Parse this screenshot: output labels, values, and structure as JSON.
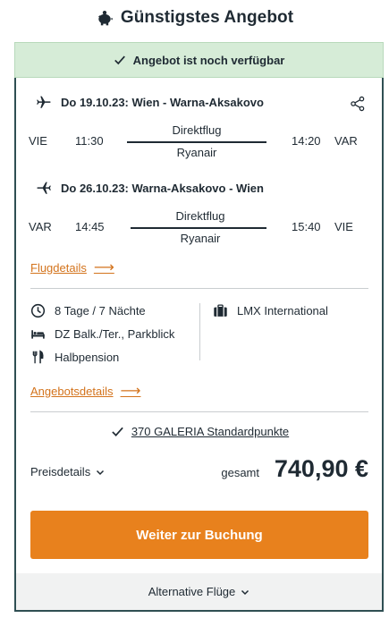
{
  "header": {
    "title": "Günstigstes Angebot",
    "icon": "piggy-bank-icon"
  },
  "availability": {
    "text": "Angebot ist noch verfügbar"
  },
  "outbound": {
    "title": "Do 19.10.23: Wien - Warna-Aksakovo",
    "from_code": "VIE",
    "dep_time": "11:30",
    "type": "Direktflug",
    "airline": "Ryanair",
    "arr_time": "14:20",
    "to_code": "VAR"
  },
  "return": {
    "title": "Do 26.10.23: Warna-Aksakovo - Wien",
    "from_code": "VAR",
    "dep_time": "14:45",
    "type": "Direktflug",
    "airline": "Ryanair",
    "arr_time": "15:40",
    "to_code": "VIE"
  },
  "flight_details_link": "Flugdetails",
  "details": {
    "duration": "8 Tage / 7 Nächte",
    "room": "DZ Balk./Ter., Parkblick",
    "board": "Halbpension",
    "operator": "LMX International"
  },
  "offer_details_link": "Angebotsdetails",
  "points": "370 GALERIA Standardpunkte",
  "price": {
    "details_label": "Preisdetails",
    "total_label": "gesamt",
    "amount": "740,90 €"
  },
  "cta": "Weiter zur Buchung",
  "alternative": "Alternative Flüge",
  "colors": {
    "accent": "#e8811d",
    "link": "#d3731c",
    "success_bg": "#d6ecd7",
    "border": "#2f4f53"
  }
}
